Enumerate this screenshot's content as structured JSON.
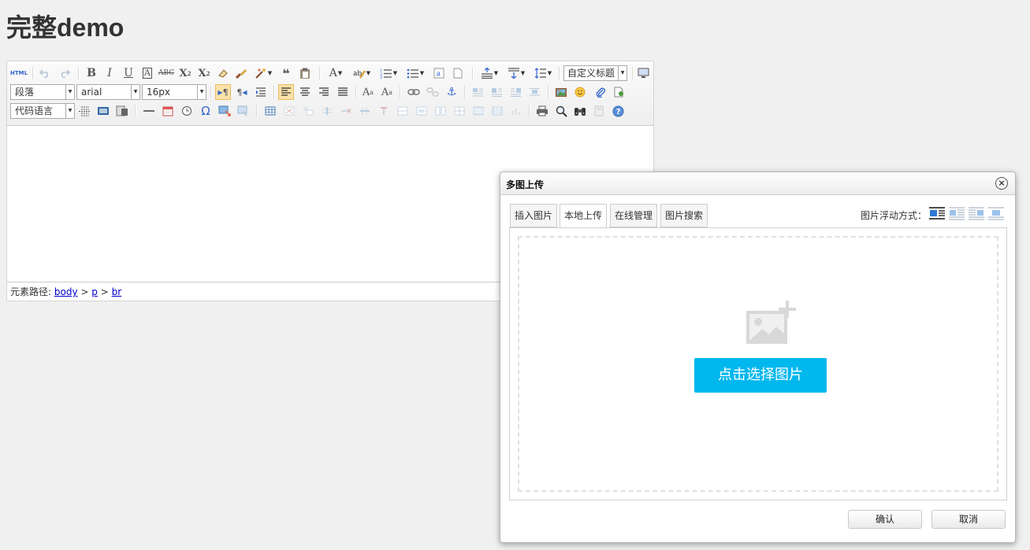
{
  "page": {
    "title": "完整demo"
  },
  "toolbar": {
    "html_label": "HTML",
    "paragraph_select": "段落",
    "font_select": "arial",
    "size_select": "16px",
    "heading_select": "自定义标题",
    "code_select": "代码语言",
    "icons_row1": [
      "html-source-icon",
      "undo-icon",
      "redo-icon",
      "bold-icon",
      "italic-icon",
      "underline-icon",
      "font-border-icon",
      "strikethrough-icon",
      "superscript-icon",
      "subscript-icon",
      "remove-format-icon",
      "format-brush-icon",
      "auto-typeset-icon",
      "blockquote-icon",
      "paste-plain-icon",
      "font-color-icon",
      "highlight-color-icon",
      "ordered-list-icon",
      "unordered-list-icon",
      "select-all-icon",
      "clear-doc-icon",
      "row-spacing-top-icon",
      "row-spacing-bottom-icon",
      "line-height-icon",
      "preview-icon"
    ],
    "accent": "#fbe2a9"
  },
  "statusbar": {
    "label": "元素路径:",
    "path": [
      "body",
      "p",
      "br"
    ],
    "separator": ">"
  },
  "dialog": {
    "title": "多图上传",
    "close_glyph": "×",
    "tabs": [
      "插入图片",
      "本地上传",
      "在线管理",
      "图片搜索"
    ],
    "active_tab": "本地上传",
    "float_label": "图片浮动方式：",
    "pick_button": "点击选择图片",
    "pick_color": "#00b7ee",
    "confirm": "确认",
    "cancel": "取消"
  }
}
